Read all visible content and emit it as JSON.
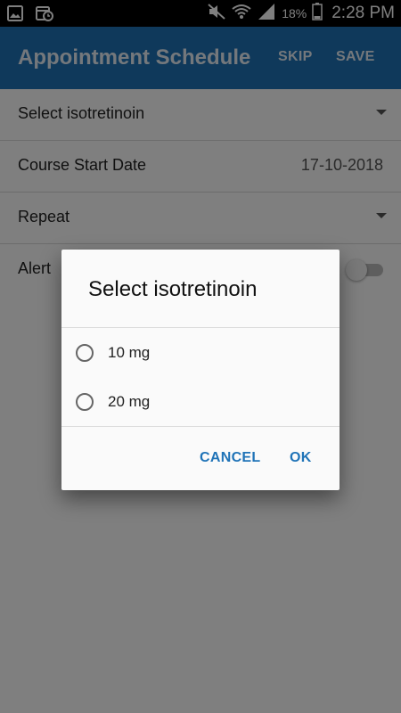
{
  "status_bar": {
    "battery": "18%",
    "time": "2:28 PM",
    "icons": [
      "gallery-icon",
      "calendar-clock-icon",
      "mute-icon",
      "wifi-icon",
      "signal-icon",
      "battery-icon"
    ]
  },
  "app_bar": {
    "title": "Appointment Schedule",
    "skip_label": "SKIP",
    "save_label": "SAVE",
    "color": "#1f73b7"
  },
  "form": {
    "medicine_label": "Select isotretinoin",
    "start_date_label": "Course Start Date",
    "start_date_value": "17-10-2018",
    "repeat_label": "Repeat",
    "alert_label": "Alert"
  },
  "dialog": {
    "title": "Select isotretinoin",
    "options": [
      {
        "label": "10 mg"
      },
      {
        "label": "20 mg"
      }
    ],
    "cancel_label": "CANCEL",
    "ok_label": "OK"
  }
}
